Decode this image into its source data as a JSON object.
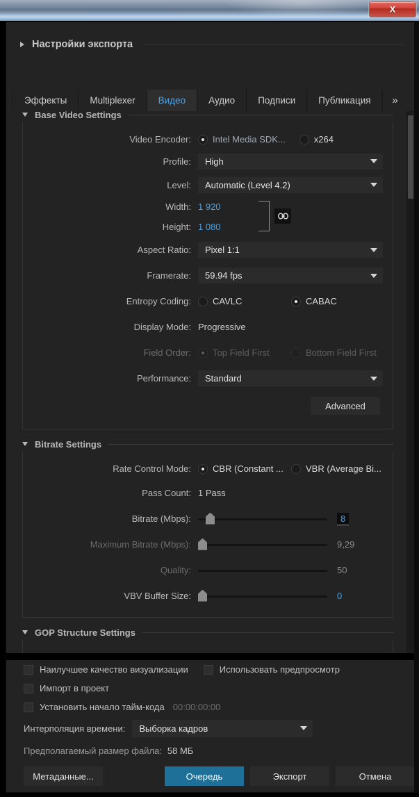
{
  "window": {
    "close_label": "X"
  },
  "header": {
    "title": "Настройки экспорта",
    "disclosure": "triangle-right"
  },
  "tabs": {
    "items": [
      {
        "label": "Эффекты",
        "active": false
      },
      {
        "label": "Multiplexer",
        "active": false
      },
      {
        "label": "Видео",
        "active": true
      },
      {
        "label": "Аудио",
        "active": false
      },
      {
        "label": "Подписи",
        "active": false
      },
      {
        "label": "Публикация",
        "active": false
      }
    ],
    "overflow": "»"
  },
  "base_video": {
    "title": "Base Video Settings",
    "video_encoder": {
      "label": "Video Encoder:",
      "options": [
        "Intel Media SDK...",
        "x264"
      ],
      "selected": "Intel Media SDK..."
    },
    "profile": {
      "label": "Profile:",
      "value": "High"
    },
    "level": {
      "label": "Level:",
      "value": "Automatic (Level 4.2)"
    },
    "width": {
      "label": "Width:",
      "value": "1 920"
    },
    "height": {
      "label": "Height:",
      "value": "1 080"
    },
    "link_icon": "link-chain-icon",
    "aspect_ratio": {
      "label": "Aspect Ratio:",
      "value": "Pixel 1:1"
    },
    "framerate": {
      "label": "Framerate:",
      "value": "59.94 fps"
    },
    "entropy_coding": {
      "label": "Entropy Coding:",
      "options": [
        "CAVLC",
        "CABAC"
      ],
      "selected": "CABAC"
    },
    "display_mode": {
      "label": "Display Mode:",
      "value": "Progressive"
    },
    "field_order": {
      "label": "Field Order:",
      "options": [
        "Top Field First",
        "Bottom Field First"
      ],
      "selected": "Top Field First",
      "disabled": true
    },
    "performance": {
      "label": "Performance:",
      "value": "Standard"
    },
    "advanced_button": "Advanced"
  },
  "bitrate": {
    "title": "Bitrate Settings",
    "rate_control_mode": {
      "label": "Rate Control Mode:",
      "options": [
        "CBR (Constant ...",
        "VBR (Average Bi..."
      ],
      "selected": "CBR (Constant ..."
    },
    "pass_count": {
      "label": "Pass Count:",
      "value": "1 Pass"
    },
    "bitrate_mbps": {
      "label": "Bitrate (Mbps):",
      "value": "8",
      "fill_pct": 7,
      "editing": true
    },
    "max_bitrate_mbps": {
      "label": "Maximum Bitrate (Mbps):",
      "value": "9,29",
      "fill_pct": 2,
      "disabled": true
    },
    "quality": {
      "label": "Quality:",
      "value": "50",
      "fill_pct": 0,
      "no_thumb": true,
      "disabled": true
    },
    "vbv_buffer_size": {
      "label": "VBV Buffer Size:",
      "value": "0",
      "fill_pct": 2
    }
  },
  "gop": {
    "title": "GOP Structure Settings"
  },
  "bottom": {
    "checkboxes": [
      {
        "label": "Наилучшее качество визуализации",
        "checked": false
      },
      {
        "label": "Использовать предпросмотр",
        "checked": false
      },
      {
        "label": "Импорт в проект",
        "checked": false
      },
      {
        "label": "Установить начало тайм-кода",
        "checked": false,
        "dim": true
      }
    ],
    "timecode_value": "00:00:00:00",
    "interpolation": {
      "label": "Интерполяция времени:",
      "value": "Выборка кадров"
    },
    "filesize": {
      "label": "Предполагаемый размер файла:",
      "value": "58 МБ"
    },
    "buttons": {
      "metadata": "Метаданные...",
      "queue": "Очередь",
      "export": "Экспорт",
      "cancel": "Отмена"
    }
  },
  "colors": {
    "accent_blue": "#4ea0e0",
    "queue_button": "#1f7098",
    "panel_bg": "#232323",
    "close_red": "#c4564c"
  }
}
